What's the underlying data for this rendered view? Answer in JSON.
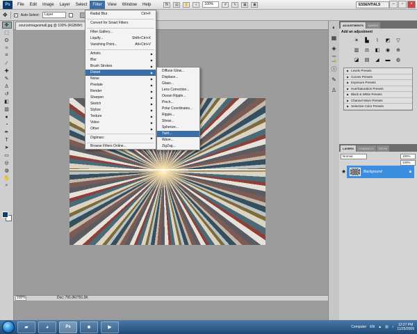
{
  "menubar": {
    "logo": "Ps",
    "items": [
      "File",
      "Edit",
      "Image",
      "Layer",
      "Select",
      "Filter",
      "View",
      "Window",
      "Help"
    ],
    "zoom": "100%",
    "workspace": "ESSENTIALS"
  },
  "options": {
    "auto_select_label": "Auto-Select:",
    "auto_select_value": "Layer"
  },
  "document": {
    "tab_label": "sourceimagesmall.jpg @ 100% (RGB/8#)",
    "status_zoom": "100%",
    "status_doc": "Doc: 791.0K/791.0K"
  },
  "filter_menu": {
    "items": [
      {
        "label": "Radial Blur",
        "shortcut": "Ctrl+F"
      },
      {
        "label": "Convert for Smart Filters",
        "shortcut": ""
      },
      {
        "label": "Filter Gallery...",
        "shortcut": ""
      },
      {
        "label": "Liquify...",
        "shortcut": "Shift+Ctrl+X"
      },
      {
        "label": "Vanishing Point...",
        "shortcut": "Alt+Ctrl+V"
      },
      {
        "label": "Artistic",
        "submenu": true
      },
      {
        "label": "Blur",
        "submenu": true
      },
      {
        "label": "Brush Strokes",
        "submenu": true
      },
      {
        "label": "Distort",
        "submenu": true,
        "highlighted": true
      },
      {
        "label": "Noise",
        "submenu": true
      },
      {
        "label": "Pixelate",
        "submenu": true
      },
      {
        "label": "Render",
        "submenu": true
      },
      {
        "label": "Sharpen",
        "submenu": true
      },
      {
        "label": "Sketch",
        "submenu": true
      },
      {
        "label": "Stylize",
        "submenu": true
      },
      {
        "label": "Texture",
        "submenu": true
      },
      {
        "label": "Video",
        "submenu": true
      },
      {
        "label": "Other",
        "submenu": true
      },
      {
        "label": "Digimarc",
        "submenu": true
      },
      {
        "label": "Browse Filters Online...",
        "shortcut": ""
      }
    ]
  },
  "distort_menu": {
    "items": [
      "Diffuse Glow...",
      "Displace...",
      "Glass...",
      "Lens Correction...",
      "Ocean Ripple...",
      "Pinch...",
      "Polar Coordinates...",
      "Ripple...",
      "Shear...",
      "Spherize...",
      "Twirl...",
      "Wave...",
      "ZigZag..."
    ],
    "highlighted_index": 10
  },
  "adjustments": {
    "tabs": [
      "ADJUSTMENTS",
      "MASKS"
    ],
    "title": "Add an adjustment",
    "presets": [
      "Levels Presets",
      "Curves Presets",
      "Exposure Presets",
      "Hue/Saturation Presets",
      "Black & White Presets",
      "Channel Mixer Presets",
      "Selective Color Presets"
    ]
  },
  "layers": {
    "tabs": [
      "LAYERS",
      "CHANNELS",
      "PATHS"
    ],
    "blend_mode": "Normal",
    "opacity": "100%",
    "fill": "100%",
    "layer_name": "Background"
  },
  "taskbar": {
    "computer_label": "Computer",
    "language": "EN",
    "time": "12:27 PM",
    "date": "11/25/2009"
  },
  "colors": {
    "menu_highlight": "#3a6ea5",
    "layer_selected": "#3c8fe0",
    "foreground": "#123e6e",
    "background": "#ffffff"
  }
}
